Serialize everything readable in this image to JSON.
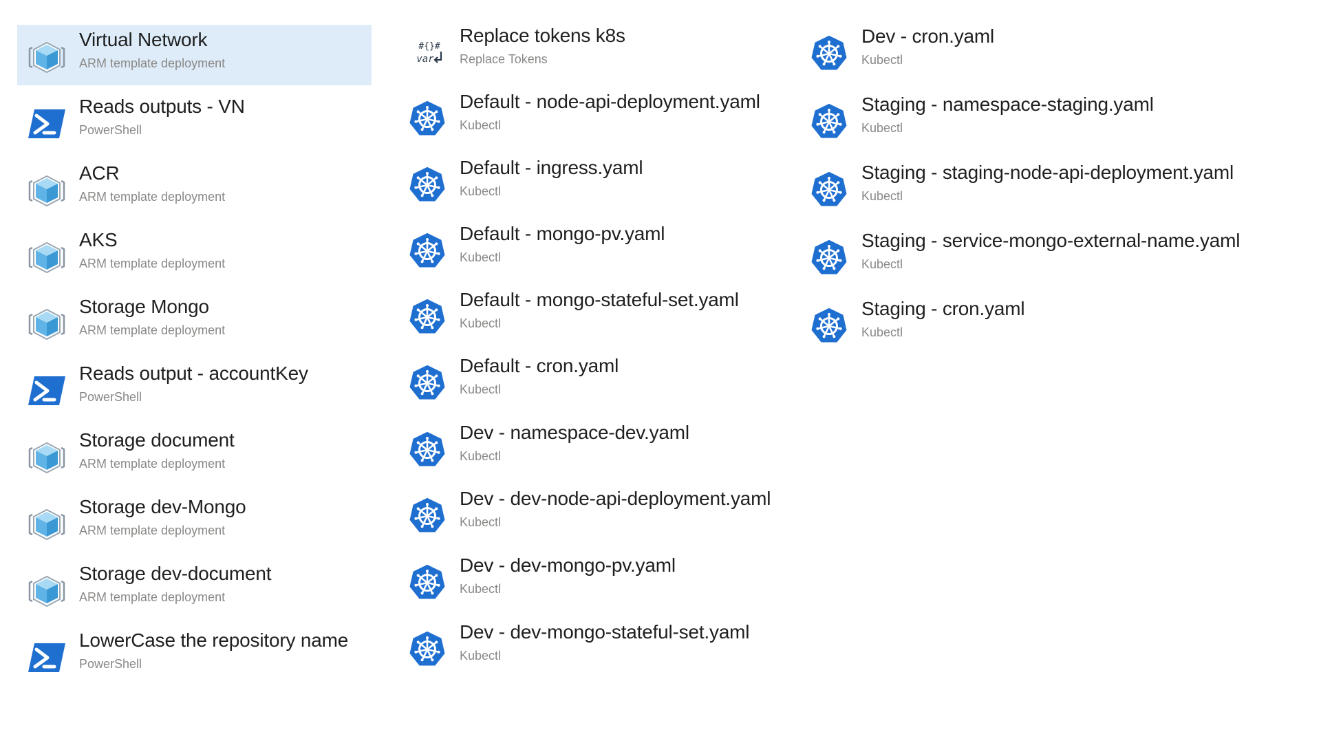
{
  "columns": [
    {
      "tasks": [
        {
          "name": "Virtual Network",
          "type": "ARM template deployment",
          "icon": "arm-template-icon",
          "selected": true
        },
        {
          "name": "Reads outputs - VN",
          "type": "PowerShell",
          "icon": "powershell-icon"
        },
        {
          "name": "ACR",
          "type": "ARM template deployment",
          "icon": "arm-template-icon"
        },
        {
          "name": "AKS",
          "type": "ARM template deployment",
          "icon": "arm-template-icon"
        },
        {
          "name": "Storage Mongo",
          "type": "ARM template deployment",
          "icon": "arm-template-icon"
        },
        {
          "name": "Reads output - accountKey",
          "type": "PowerShell",
          "icon": "powershell-icon"
        },
        {
          "name": "Storage document",
          "type": "ARM template deployment",
          "icon": "arm-template-icon"
        },
        {
          "name": "Storage dev-Mongo",
          "type": "ARM template deployment",
          "icon": "arm-template-icon"
        },
        {
          "name": "Storage dev-document",
          "type": "ARM template deployment",
          "icon": "arm-template-icon"
        },
        {
          "name": "LowerCase the repository name",
          "type": "PowerShell",
          "icon": "powershell-icon"
        }
      ]
    },
    {
      "tasks": [
        {
          "name": "Replace tokens k8s",
          "type": "Replace Tokens",
          "icon": "replace-tokens-icon"
        },
        {
          "name": "Default - node-api-deployment.yaml",
          "type": "Kubectl",
          "icon": "kubernetes-icon"
        },
        {
          "name": "Default - ingress.yaml",
          "type": "Kubectl",
          "icon": "kubernetes-icon"
        },
        {
          "name": "Default - mongo-pv.yaml",
          "type": "Kubectl",
          "icon": "kubernetes-icon"
        },
        {
          "name": "Default - mongo-stateful-set.yaml",
          "type": "Kubectl",
          "icon": "kubernetes-icon"
        },
        {
          "name": "Default - cron.yaml",
          "type": "Kubectl",
          "icon": "kubernetes-icon"
        },
        {
          "name": "Dev - namespace-dev.yaml",
          "type": "Kubectl",
          "icon": "kubernetes-icon"
        },
        {
          "name": "Dev - dev-node-api-deployment.yaml",
          "type": "Kubectl",
          "icon": "kubernetes-icon"
        },
        {
          "name": "Dev - dev-mongo-pv.yaml",
          "type": "Kubectl",
          "icon": "kubernetes-icon"
        },
        {
          "name": "Dev - dev-mongo-stateful-set.yaml",
          "type": "Kubectl",
          "icon": "kubernetes-icon"
        }
      ]
    },
    {
      "tasks": [
        {
          "name": "Dev - cron.yaml",
          "type": "Kubectl",
          "icon": "kubernetes-icon"
        },
        {
          "name": "Staging - namespace-staging.yaml",
          "type": "Kubectl",
          "icon": "kubernetes-icon"
        },
        {
          "name": "Staging - staging-node-api-deployment.yaml",
          "type": "Kubectl",
          "icon": "kubernetes-icon"
        },
        {
          "name": "Staging - service-mongo-external-name.yaml",
          "type": "Kubectl",
          "icon": "kubernetes-icon"
        },
        {
          "name": "Staging - cron.yaml",
          "type": "Kubectl",
          "icon": "kubernetes-icon"
        }
      ]
    }
  ],
  "colors": {
    "selected_bg": "#deecf9",
    "powershell_blue": "#1f6fd1",
    "kubernetes_blue": "#1f6fd1",
    "arm_cube": "#5fb3e6",
    "name_text": "#1f1f1f",
    "type_text": "#8a8886"
  }
}
